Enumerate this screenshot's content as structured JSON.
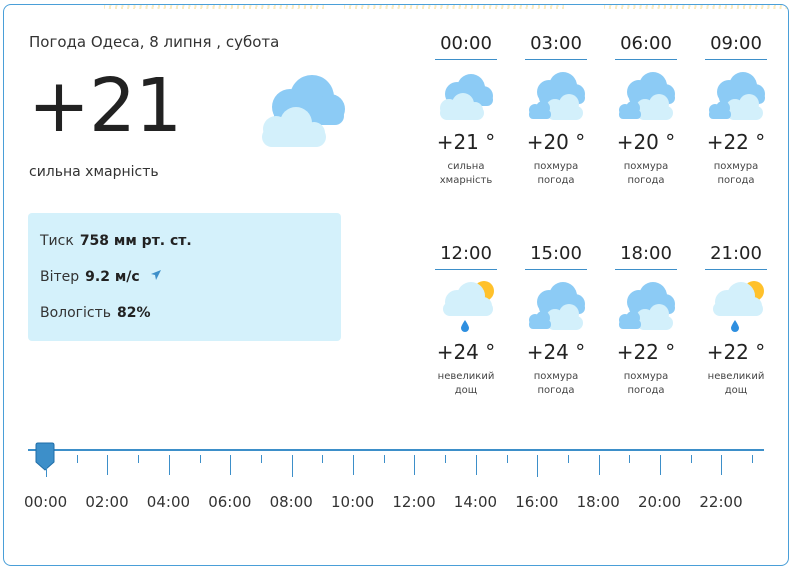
{
  "current": {
    "title": "Погода Одеса, 8 липня , субота",
    "temperature": "+21",
    "description": "сильна хмарність",
    "icon": "cloud-icon"
  },
  "details": {
    "pressure_label": "Тиск",
    "pressure_value": "758 мм рт. ст.",
    "wind_label": "Вітер",
    "wind_value": "9.2 м/с",
    "humidity_label": "Вологість",
    "humidity_value": "82%"
  },
  "hourly": [
    {
      "time": "00:00",
      "temp": "+21 °",
      "desc1": "сильна",
      "desc2": "хмарність",
      "icon": "cloud-icon"
    },
    {
      "time": "03:00",
      "temp": "+20 °",
      "desc1": "похмура",
      "desc2": "погода",
      "icon": "clouds-icon"
    },
    {
      "time": "06:00",
      "temp": "+20 °",
      "desc1": "похмура",
      "desc2": "погода",
      "icon": "clouds-icon"
    },
    {
      "time": "09:00",
      "temp": "+22 °",
      "desc1": "похмура",
      "desc2": "погода",
      "icon": "clouds-icon"
    },
    {
      "time": "12:00",
      "temp": "+24 °",
      "desc1": "невеликий",
      "desc2": "дощ",
      "icon": "sun-rain-icon"
    },
    {
      "time": "15:00",
      "temp": "+24 °",
      "desc1": "похмура",
      "desc2": "погода",
      "icon": "clouds-icon"
    },
    {
      "time": "18:00",
      "temp": "+22 °",
      "desc1": "похмура",
      "desc2": "погода",
      "icon": "clouds-icon"
    },
    {
      "time": "21:00",
      "temp": "+22 °",
      "desc1": "невеликий",
      "desc2": "дощ",
      "icon": "sun-rain-icon"
    }
  ],
  "timeline": {
    "labels": [
      "00:00",
      "02:00",
      "04:00",
      "06:00",
      "08:00",
      "10:00",
      "12:00",
      "14:00",
      "16:00",
      "18:00",
      "20:00",
      "22:00"
    ],
    "selected": "00:00"
  },
  "colors": {
    "accent": "#3d8fc9",
    "cloud_light": "#d3f0fb",
    "cloud_dark": "#8ccbf5",
    "sun": "#ffc12b",
    "rain": "#2e8fe0",
    "details_bg": "#d4f1fb"
  }
}
